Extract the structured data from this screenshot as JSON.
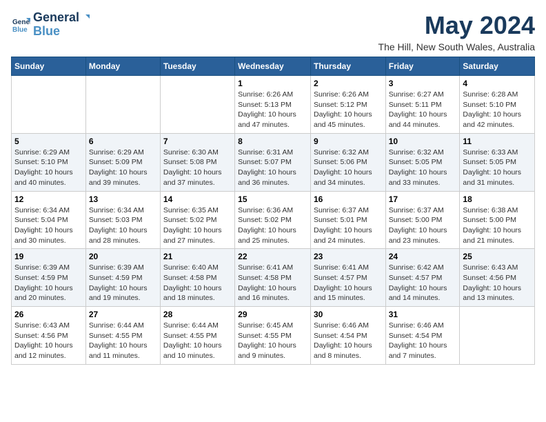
{
  "header": {
    "logo_line1": "General",
    "logo_line2": "Blue",
    "month_title": "May 2024",
    "location": "The Hill, New South Wales, Australia"
  },
  "days_of_week": [
    "Sunday",
    "Monday",
    "Tuesday",
    "Wednesday",
    "Thursday",
    "Friday",
    "Saturday"
  ],
  "weeks": [
    [
      {
        "day": "",
        "info": ""
      },
      {
        "day": "",
        "info": ""
      },
      {
        "day": "",
        "info": ""
      },
      {
        "day": "1",
        "info": "Sunrise: 6:26 AM\nSunset: 5:13 PM\nDaylight: 10 hours and 47 minutes."
      },
      {
        "day": "2",
        "info": "Sunrise: 6:26 AM\nSunset: 5:12 PM\nDaylight: 10 hours and 45 minutes."
      },
      {
        "day": "3",
        "info": "Sunrise: 6:27 AM\nSunset: 5:11 PM\nDaylight: 10 hours and 44 minutes."
      },
      {
        "day": "4",
        "info": "Sunrise: 6:28 AM\nSunset: 5:10 PM\nDaylight: 10 hours and 42 minutes."
      }
    ],
    [
      {
        "day": "5",
        "info": "Sunrise: 6:29 AM\nSunset: 5:10 PM\nDaylight: 10 hours and 40 minutes."
      },
      {
        "day": "6",
        "info": "Sunrise: 6:29 AM\nSunset: 5:09 PM\nDaylight: 10 hours and 39 minutes."
      },
      {
        "day": "7",
        "info": "Sunrise: 6:30 AM\nSunset: 5:08 PM\nDaylight: 10 hours and 37 minutes."
      },
      {
        "day": "8",
        "info": "Sunrise: 6:31 AM\nSunset: 5:07 PM\nDaylight: 10 hours and 36 minutes."
      },
      {
        "day": "9",
        "info": "Sunrise: 6:32 AM\nSunset: 5:06 PM\nDaylight: 10 hours and 34 minutes."
      },
      {
        "day": "10",
        "info": "Sunrise: 6:32 AM\nSunset: 5:05 PM\nDaylight: 10 hours and 33 minutes."
      },
      {
        "day": "11",
        "info": "Sunrise: 6:33 AM\nSunset: 5:05 PM\nDaylight: 10 hours and 31 minutes."
      }
    ],
    [
      {
        "day": "12",
        "info": "Sunrise: 6:34 AM\nSunset: 5:04 PM\nDaylight: 10 hours and 30 minutes."
      },
      {
        "day": "13",
        "info": "Sunrise: 6:34 AM\nSunset: 5:03 PM\nDaylight: 10 hours and 28 minutes."
      },
      {
        "day": "14",
        "info": "Sunrise: 6:35 AM\nSunset: 5:02 PM\nDaylight: 10 hours and 27 minutes."
      },
      {
        "day": "15",
        "info": "Sunrise: 6:36 AM\nSunset: 5:02 PM\nDaylight: 10 hours and 25 minutes."
      },
      {
        "day": "16",
        "info": "Sunrise: 6:37 AM\nSunset: 5:01 PM\nDaylight: 10 hours and 24 minutes."
      },
      {
        "day": "17",
        "info": "Sunrise: 6:37 AM\nSunset: 5:00 PM\nDaylight: 10 hours and 23 minutes."
      },
      {
        "day": "18",
        "info": "Sunrise: 6:38 AM\nSunset: 5:00 PM\nDaylight: 10 hours and 21 minutes."
      }
    ],
    [
      {
        "day": "19",
        "info": "Sunrise: 6:39 AM\nSunset: 4:59 PM\nDaylight: 10 hours and 20 minutes."
      },
      {
        "day": "20",
        "info": "Sunrise: 6:39 AM\nSunset: 4:59 PM\nDaylight: 10 hours and 19 minutes."
      },
      {
        "day": "21",
        "info": "Sunrise: 6:40 AM\nSunset: 4:58 PM\nDaylight: 10 hours and 18 minutes."
      },
      {
        "day": "22",
        "info": "Sunrise: 6:41 AM\nSunset: 4:58 PM\nDaylight: 10 hours and 16 minutes."
      },
      {
        "day": "23",
        "info": "Sunrise: 6:41 AM\nSunset: 4:57 PM\nDaylight: 10 hours and 15 minutes."
      },
      {
        "day": "24",
        "info": "Sunrise: 6:42 AM\nSunset: 4:57 PM\nDaylight: 10 hours and 14 minutes."
      },
      {
        "day": "25",
        "info": "Sunrise: 6:43 AM\nSunset: 4:56 PM\nDaylight: 10 hours and 13 minutes."
      }
    ],
    [
      {
        "day": "26",
        "info": "Sunrise: 6:43 AM\nSunset: 4:56 PM\nDaylight: 10 hours and 12 minutes."
      },
      {
        "day": "27",
        "info": "Sunrise: 6:44 AM\nSunset: 4:55 PM\nDaylight: 10 hours and 11 minutes."
      },
      {
        "day": "28",
        "info": "Sunrise: 6:44 AM\nSunset: 4:55 PM\nDaylight: 10 hours and 10 minutes."
      },
      {
        "day": "29",
        "info": "Sunrise: 6:45 AM\nSunset: 4:55 PM\nDaylight: 10 hours and 9 minutes."
      },
      {
        "day": "30",
        "info": "Sunrise: 6:46 AM\nSunset: 4:54 PM\nDaylight: 10 hours and 8 minutes."
      },
      {
        "day": "31",
        "info": "Sunrise: 6:46 AM\nSunset: 4:54 PM\nDaylight: 10 hours and 7 minutes."
      },
      {
        "day": "",
        "info": ""
      }
    ]
  ]
}
